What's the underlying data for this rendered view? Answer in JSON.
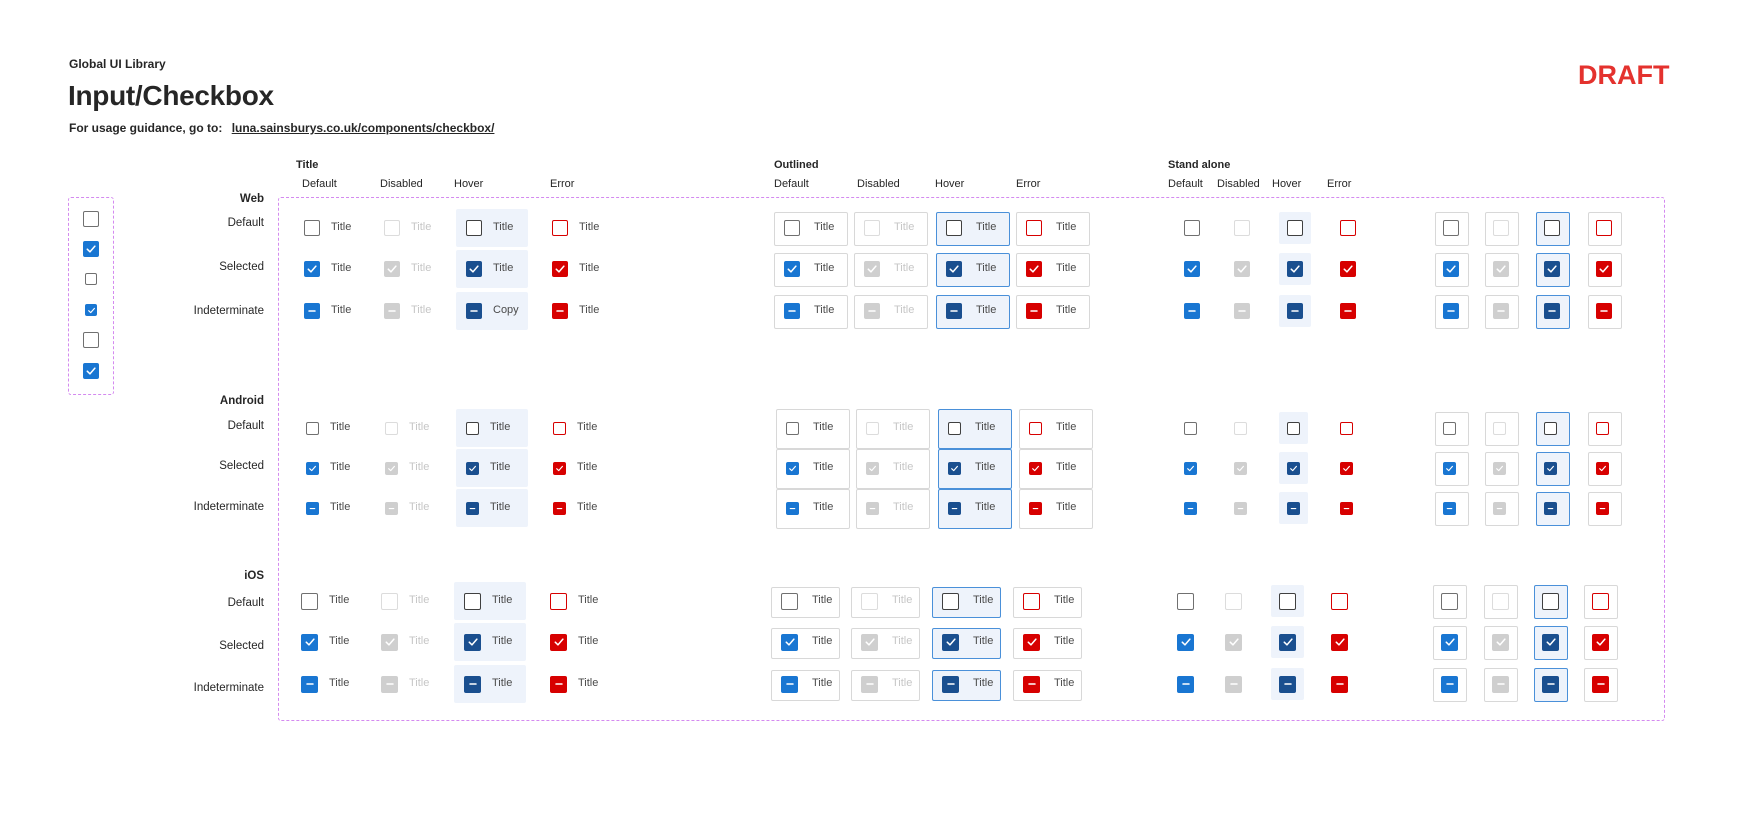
{
  "header": {
    "library": "Global UI Library",
    "title": "Input/Checkbox",
    "guidance_prefix": "For usage guidance, go to:",
    "guidance_link": "luna.sainsburys.co.uk/components/checkbox/",
    "draft": "DRAFT"
  },
  "groups": {
    "title": "Title",
    "outlined": "Outlined",
    "standalone": "Stand alone"
  },
  "columns": {
    "default": "Default",
    "disabled": "Disabled",
    "hover": "Hover",
    "error": "Error"
  },
  "platforms": {
    "web": "Web",
    "android": "Android",
    "ios": "iOS"
  },
  "rows": {
    "default": "Default",
    "selected": "Selected",
    "indeterminate": "Indeterminate"
  },
  "item_text": "Title",
  "web_indeterminate_hover_text": "Copy",
  "colors": {
    "primary": "#1976d2",
    "hover": "#1a4f8f",
    "error": "#d70000",
    "disabled": "#cfcfcf",
    "draft": "#e4322e",
    "dashed_border": "#d48af0"
  },
  "icons": [
    "checkbox-unchecked-icon",
    "checkbox-checked-icon",
    "checkbox-indeterminate-icon"
  ]
}
